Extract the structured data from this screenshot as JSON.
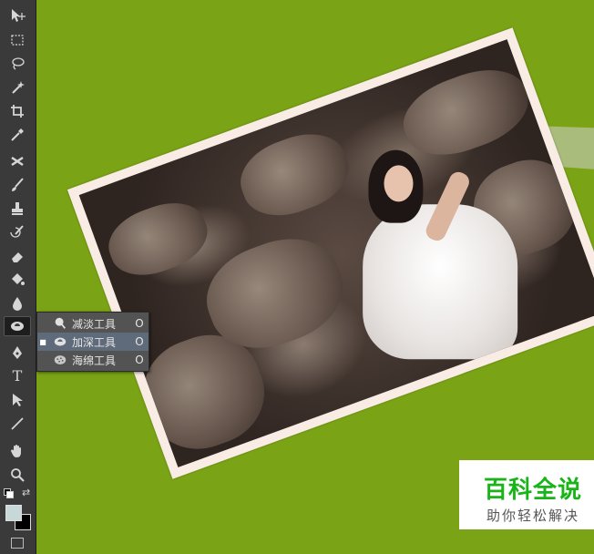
{
  "toolbar": {
    "tools": [
      {
        "name": "move-tool",
        "icon": "move-icon"
      },
      {
        "name": "marquee-tool",
        "icon": "marquee-icon"
      },
      {
        "name": "lasso-tool",
        "icon": "lasso-icon"
      },
      {
        "name": "magic-wand-tool",
        "icon": "magic-wand-icon"
      },
      {
        "name": "crop-tool",
        "icon": "crop-icon"
      },
      {
        "name": "eyedropper-tool",
        "icon": "eyedropper-icon"
      },
      {
        "name": "healing-brush-tool",
        "icon": "healing-icon"
      },
      {
        "name": "brush-tool",
        "icon": "brush-icon"
      },
      {
        "name": "clone-stamp-tool",
        "icon": "stamp-icon"
      },
      {
        "name": "history-brush-tool",
        "icon": "history-brush-icon"
      },
      {
        "name": "eraser-tool",
        "icon": "eraser-icon"
      },
      {
        "name": "paint-bucket-tool",
        "icon": "paint-bucket-icon"
      },
      {
        "name": "blur-tool",
        "icon": "drop-icon"
      },
      {
        "name": "burn-tool",
        "icon": "burn-icon"
      },
      {
        "name": "pen-tool",
        "icon": "pen-icon"
      },
      {
        "name": "type-tool",
        "icon": "type-icon"
      },
      {
        "name": "path-selection-tool",
        "icon": "arrow-icon"
      },
      {
        "name": "line-tool",
        "icon": "line-icon"
      },
      {
        "name": "hand-tool",
        "icon": "hand-icon"
      },
      {
        "name": "zoom-tool",
        "icon": "zoom-icon"
      }
    ],
    "type_glyph": "T",
    "foreground_color": "#c8d8d8",
    "background_color": "#000000"
  },
  "flyout": {
    "items": [
      {
        "label": "减淡工具",
        "shortcut": "O",
        "selected": false,
        "icon": "dodge-icon"
      },
      {
        "label": "加深工具",
        "shortcut": "O",
        "selected": true,
        "icon": "burn-icon"
      },
      {
        "label": "海绵工具",
        "shortcut": "O",
        "selected": false,
        "icon": "sponge-icon"
      }
    ],
    "selected_marker": "■"
  },
  "watermark": {
    "title": "百科全说",
    "subtitle": "助你轻松解决"
  },
  "colors": {
    "canvas_background": "#7aa315",
    "photo_border": "#f8ece4",
    "watermark_title": "#18b418"
  }
}
